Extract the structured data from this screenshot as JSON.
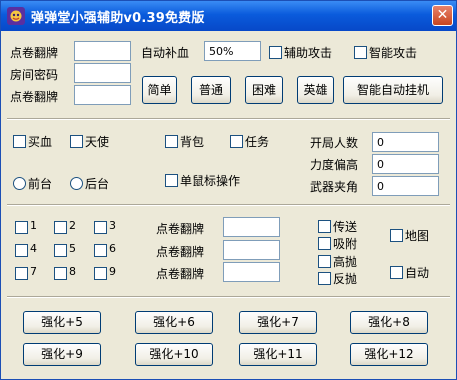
{
  "window": {
    "title": "弹弹堂小强辅助v0.39免费版",
    "close_glyph": "✕"
  },
  "top": {
    "labels": [
      "点卷翻牌",
      "房间密码",
      "点卷翻牌"
    ],
    "inputs": [
      "",
      "",
      ""
    ],
    "auto_heal_label": "自动补血",
    "auto_heal_value": "50%",
    "assist_attack": "辅助攻击",
    "smart_attack": "智能攻击",
    "difficulty_buttons": [
      "简单",
      "普通",
      "困难",
      "英雄"
    ],
    "auto_hang_button": "智能自动挂机"
  },
  "mid": {
    "buy_blood": "买血",
    "angel": "天使",
    "backpack": "背包",
    "task": "任务",
    "foreground": "前台",
    "background": "后台",
    "single_mouse": "单鼠标操作",
    "start_players_label": "开局人数",
    "start_players_value": "0",
    "force_offset_label": "力度偏高",
    "force_offset_value": "0",
    "weapon_angle_label": "武器夹角",
    "weapon_angle_value": "0"
  },
  "lower": {
    "numbers": [
      "1",
      "2",
      "3",
      "4",
      "5",
      "6",
      "7",
      "8",
      "9"
    ],
    "flip_labels": [
      "点卷翻牌",
      "点卷翻牌",
      "点卷翻牌"
    ],
    "flip_values": [
      "",
      "",
      ""
    ],
    "teleport": "传送",
    "absorb": "吸附",
    "high_throw": "高抛",
    "reverse_throw": "反抛",
    "map": "地图",
    "auto": "自动"
  },
  "strengthen": [
    "强化+5",
    "强化+6",
    "强化+7",
    "强化+8",
    "强化+9",
    "强化+10",
    "强化+11",
    "强化+12"
  ]
}
